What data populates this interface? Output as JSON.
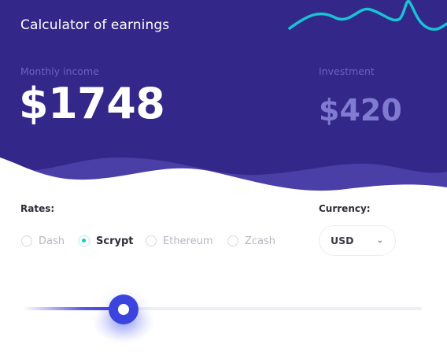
{
  "header": {
    "title": "Calculator of earnings",
    "monthly_income_label": "Monthly income",
    "monthly_income_value": "$1748",
    "investment_label": "Investment",
    "investment_value": "$420"
  },
  "rates": {
    "label": "Rates:",
    "options": [
      {
        "label": "Dash",
        "selected": false
      },
      {
        "label": "Scrypt",
        "selected": true
      },
      {
        "label": "Ethereum",
        "selected": false
      },
      {
        "label": "Zcash",
        "selected": false
      }
    ]
  },
  "currency": {
    "label": "Currency:",
    "selected": "USD",
    "chevron_icon": "chevron-down-icon"
  },
  "slider": {
    "value_fraction": 0.25
  },
  "colors": {
    "header_bg": "#33278a",
    "wave_light": "#4a3fa6",
    "accent_cyan": "#19c3d3",
    "slider_thumb": "#3b45dd",
    "muted_label": "#6b62bf"
  }
}
